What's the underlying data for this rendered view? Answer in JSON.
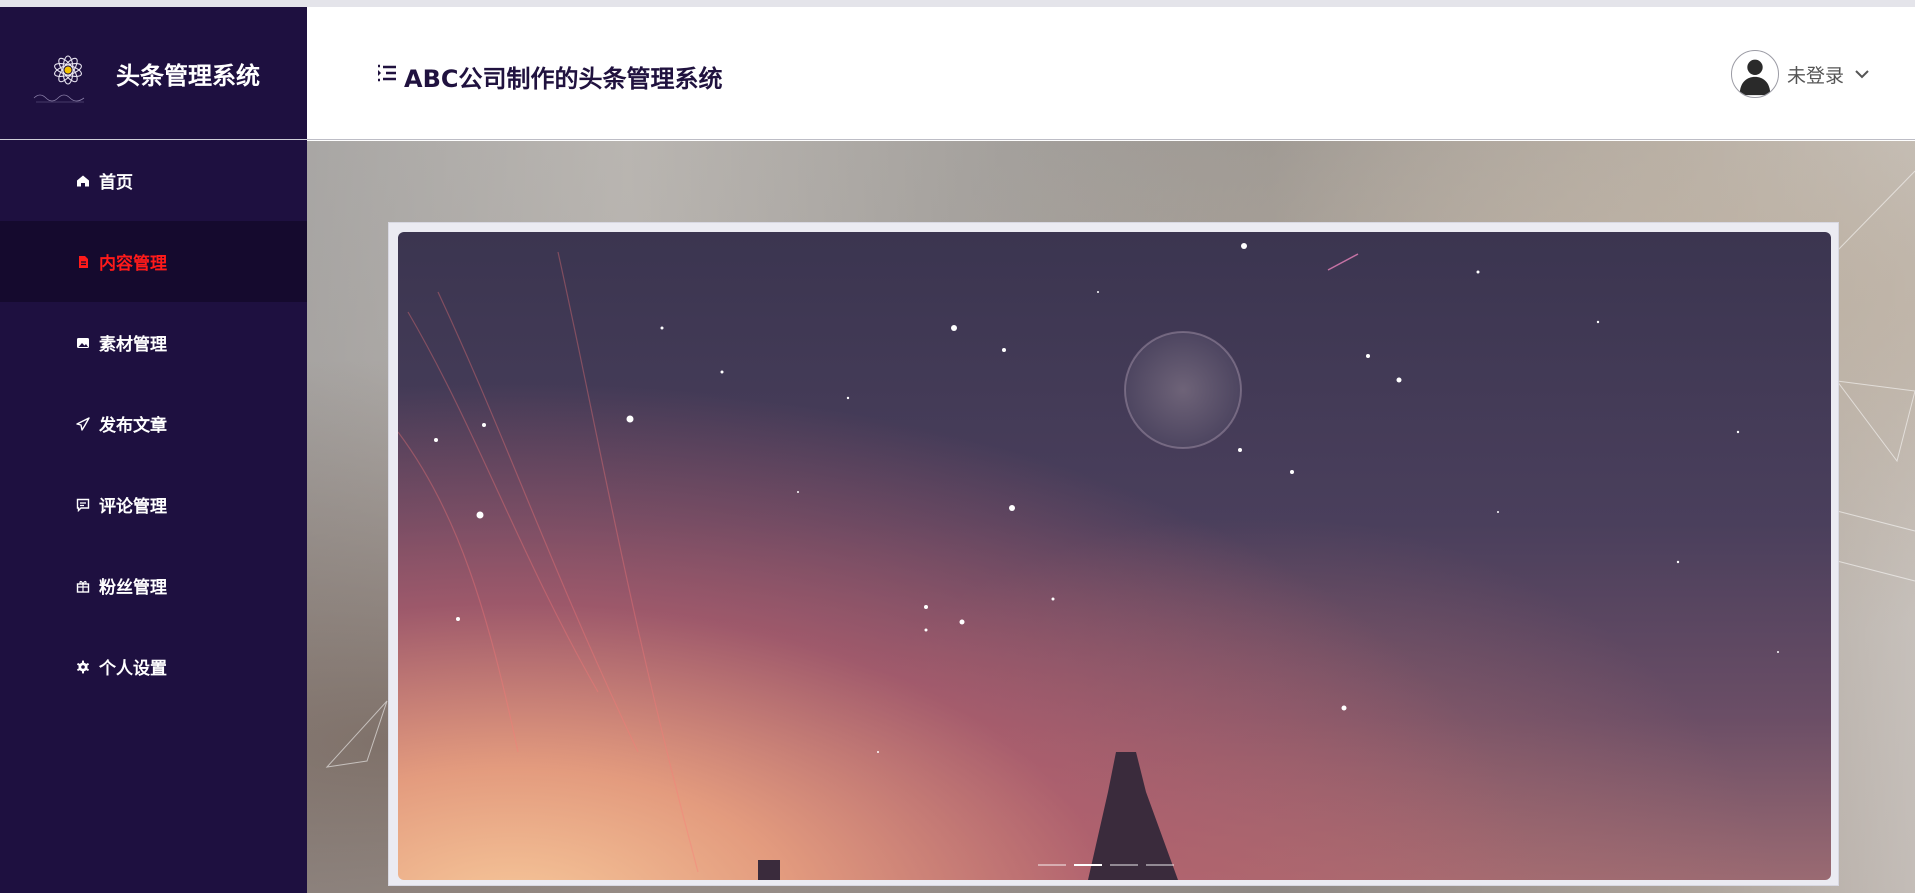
{
  "brand": {
    "title": "头条管理系统"
  },
  "header": {
    "title": "ABC公司制作的头条管理系统"
  },
  "user": {
    "name": "未登录"
  },
  "sidebar": {
    "items": [
      {
        "label": "首页",
        "icon": "home-icon"
      },
      {
        "label": "内容管理",
        "icon": "document-icon",
        "active": true
      },
      {
        "label": "素材管理",
        "icon": "image-icon"
      },
      {
        "label": "发布文章",
        "icon": "send-icon"
      },
      {
        "label": "评论管理",
        "icon": "comment-icon"
      },
      {
        "label": "粉丝管理",
        "icon": "gift-icon"
      },
      {
        "label": "个人设置",
        "icon": "gear-icon"
      }
    ]
  },
  "carousel": {
    "slide_count": 4,
    "active_index": 1
  },
  "colors": {
    "sidebar_bg": "#1e1040",
    "active_item_bg": "#150a2e",
    "active_text": "#ff1a1a",
    "header_title": "#20123f"
  }
}
